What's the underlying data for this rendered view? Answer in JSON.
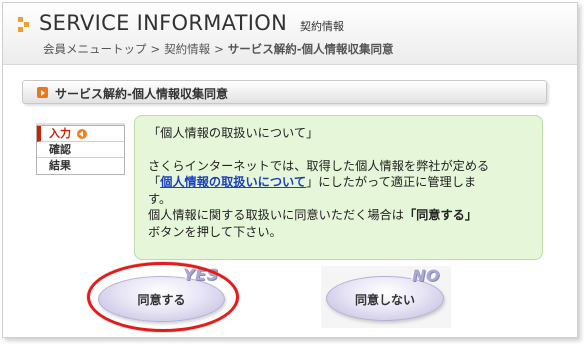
{
  "header": {
    "title": "SERVICE INFORMATION",
    "subtitle": "契約情報",
    "breadcrumb": [
      "会員メニュートップ",
      "契約情報",
      "サービス解約-個人情報収集同意"
    ],
    "breadcrumb_separator": ">"
  },
  "section": {
    "label": "サービス解約-個人情報収集同意",
    "bullet_icon": "orange-arrow-bullet-icon"
  },
  "steps": [
    {
      "label": "入力",
      "active": true,
      "icon": "current-step-arrow-icon"
    },
    {
      "label": "確認",
      "active": false
    },
    {
      "label": "結果",
      "active": false
    }
  ],
  "info": {
    "heading": "「個人情報の取扱いについて」",
    "line1": "さくらインターネットでは、取得した個人情報を弊社が定める",
    "quote_open": "「",
    "link_label": "個人情報の取扱いについて",
    "line2_rest": "」にしたがって適正に管理しま",
    "line3": "す。",
    "line4_pre": "個人情報に関する取扱いに同意いただく場合は",
    "line4_bold": "「同意する」",
    "line5": "ボタンを押して下さい。"
  },
  "buttons": {
    "agree": {
      "label": "同意する",
      "tag": "YES",
      "highlighted": true
    },
    "disagree": {
      "label": "同意しない",
      "tag": "NO"
    }
  },
  "colors": {
    "accent_orange": "#f0a030",
    "info_bg": "#e6f6d9",
    "link": "#1a3fbf",
    "highlight_ring": "#e31b1b",
    "active_step": "#cc2200"
  }
}
